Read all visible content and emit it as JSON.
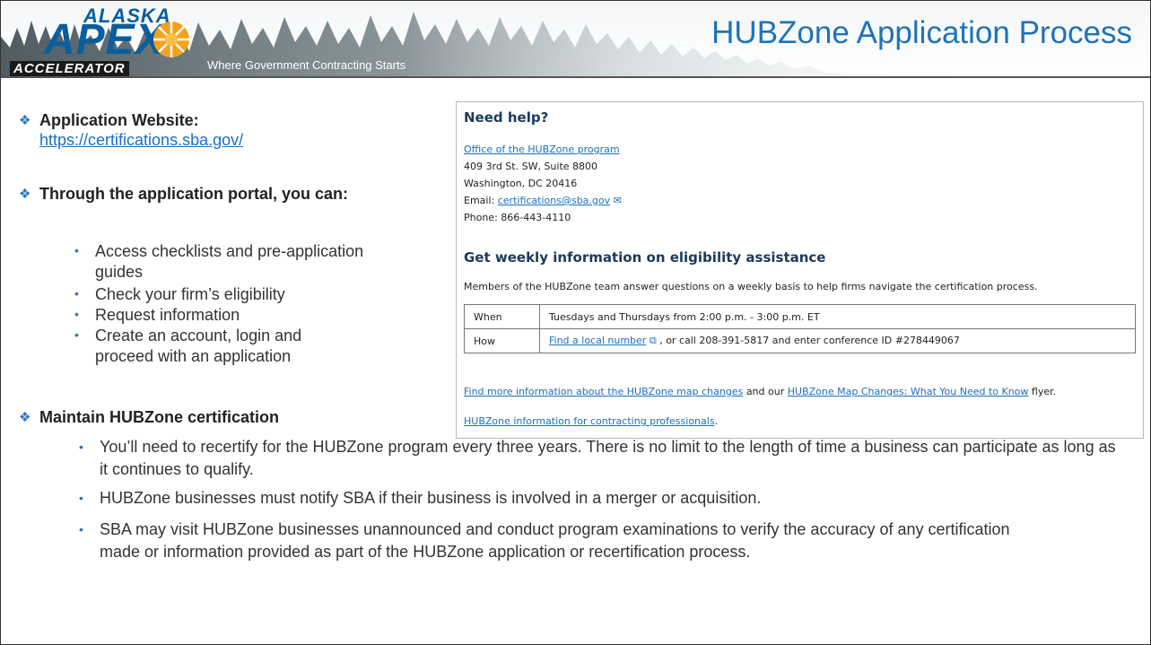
{
  "header": {
    "logo_top": "ALASKA",
    "logo_main": "APEX",
    "logo_bottom": "ACCELERATOR",
    "tagline": "Where Government Contracting Starts",
    "title": "HUBZone Application Process"
  },
  "left": {
    "website_label": "Application Website:",
    "website_url": "https://certifications.sba.gov/",
    "portal_label": "Through the application portal, you can:",
    "portal_items": [
      "Access checklists and pre-application guides",
      "Check your firm’s eligibility",
      "Request information",
      "Create an account, login and proceed with an application"
    ],
    "maintain_label": "Maintain HUBZone certification"
  },
  "inset": {
    "need_help": "Need help?",
    "office_link": "Office of the HUBZone program",
    "address1": "409 3rd St. SW, Suite 8800",
    "address2": "Washington, DC 20416",
    "email_label": "Email:",
    "email_link": "certifications@sba.gov",
    "phone": "Phone: 866-443-4110",
    "weekly_heading": "Get weekly information on eligibility assistance",
    "weekly_text": "Members of the HUBZone team answer questions on a weekly basis to help firms navigate the certification process.",
    "table": [
      {
        "key": "When",
        "value": "Tuesdays and Thursdays from 2:00 p.m. - 3:00 p.m. ET"
      },
      {
        "key": "How",
        "link": "Find a local number",
        "rest": ", or call 208-391-5817 and enter conference ID #278449067"
      }
    ],
    "more_link": "Find more information about the HUBZone map changes",
    "more_mid": "and our",
    "flyer_link": "HUBZone Map Changes: What You Need to Know",
    "flyer_end": "flyer.",
    "contracting_link": "HUBZone information for contracting professionals",
    "contracting_end": "."
  },
  "bottom": {
    "items": [
      "You’ll need to recertify for the HUBZone program every three years. There is no limit to the length of time a business can participate as long as it continues to qualify.",
      "HUBZone businesses must notify SBA if their business is involved in a merger or acquisition.",
      "SBA may visit HUBZone businesses unannounced and conduct program examinations to verify the accuracy of any certification made or information provided as part of the HUBZone application or recertification process."
    ]
  },
  "colors": {
    "title_blue": "#1f73b8",
    "bullet_blue": "#2b74bc",
    "link_blue": "#1a6fc4",
    "logo_blue": "#0a5e9c"
  },
  "icons": {
    "bullet": "diamond-bullet-icon",
    "email": "mail-icon",
    "external": "external-link-icon"
  }
}
